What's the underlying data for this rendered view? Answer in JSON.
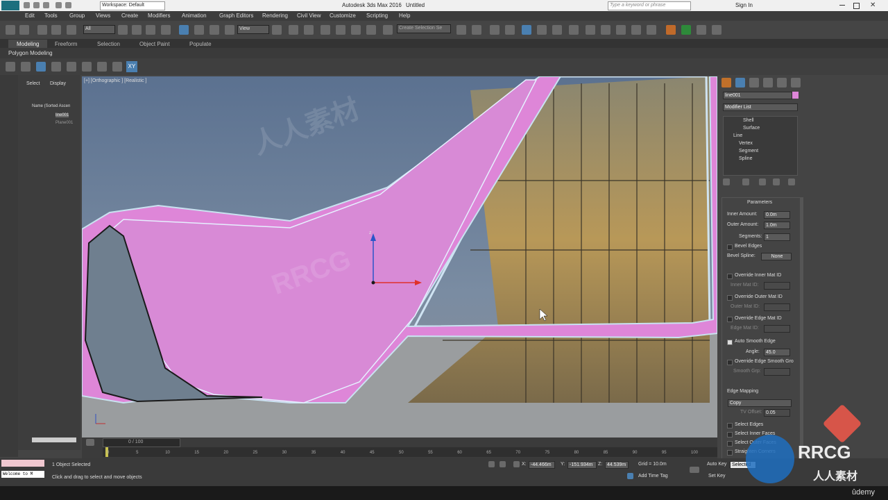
{
  "window": {
    "app_title": "Autodesk 3ds Max 2016",
    "doc_title": "Untitled",
    "workspace": "Workspace: Default",
    "search_placeholder": "Type a keyword or phrase",
    "sign_in": "Sign In"
  },
  "menu": [
    "Edit",
    "Tools",
    "Group",
    "Views",
    "Create",
    "Modifiers",
    "Animation",
    "Graph Editors",
    "Rendering",
    "Civil View",
    "Customize",
    "Scripting",
    "Help"
  ],
  "toolbar": {
    "filter_value": "All",
    "view_value": "View",
    "selection_set": "Create Selection Se"
  },
  "ribbon": {
    "tabs": [
      "Modeling",
      "Freeform",
      "Selection",
      "Object Paint",
      "Populate"
    ],
    "panel": "Polygon Modeling"
  },
  "scene_explorer": {
    "tabs": [
      "Select",
      "Display"
    ],
    "header": "Name (Sorted Ascen",
    "items": [
      "line001",
      "Plane001"
    ]
  },
  "viewport": {
    "label": "[+] [Orthographic ] [Realistic ]",
    "axis_z": "z"
  },
  "command_panel": {
    "object_name": "line001",
    "modifier_list": "Modifier List",
    "stack": [
      "Shell",
      "Surface",
      "Line",
      "Vertex",
      "Segment",
      "Spline"
    ],
    "parameters_title": "Parameters",
    "inner_amount_label": "Inner Amount:",
    "inner_amount": "0.0m",
    "outer_amount_label": "Outer Amount:",
    "outer_amount": "1.0m",
    "segments_label": "Segments:",
    "segments": "1",
    "bevel_edges": "Bevel Edges",
    "bevel_spline_label": "Bevel Spline:",
    "bevel_spline": "None",
    "override_inner": "Override Inner Mat ID",
    "inner_mat_id": "Inner Mat ID:",
    "override_outer": "Override Outer Mat ID",
    "outer_mat_id": "Outer Mat ID:",
    "override_edge": "Override Edge Mat ID",
    "edge_mat_id": "Edge Mat ID:",
    "auto_smooth": "Auto Smooth Edge",
    "angle_label": "Angle:",
    "angle": "45.0",
    "override_smooth": "Override Edge Smooth Gro",
    "smooth_grp": "Smooth Grp:",
    "edge_mapping": "Edge Mapping",
    "edge_mapping_value": "Copy",
    "tv_offset_label": "TV Offset:",
    "tv_offset": "0.05",
    "select_edges": "Select Edges",
    "select_inner": "Select Inner Faces",
    "select_outer": "Select Outer Faces",
    "straighten": "Straighten Corners"
  },
  "timeline": {
    "frame": "0 / 100",
    "ticks": [
      "0",
      "5",
      "10",
      "15",
      "20",
      "25",
      "30",
      "35",
      "40",
      "45",
      "50",
      "55",
      "60",
      "65",
      "70",
      "75",
      "80",
      "85",
      "90",
      "95",
      "100"
    ]
  },
  "status": {
    "selected": "1 Object Selected",
    "prompt": "Click and drag to select and move objects",
    "x_label": "X:",
    "x": "-44.466m",
    "y_label": "Y:",
    "y": "-151.934m",
    "z_label": "Z:",
    "z": "44.539m",
    "grid": "Grid = 10.0m",
    "add_time_tag": "Add Time Tag",
    "auto_key": "Auto Key",
    "set_key": "Set Key",
    "key_selected": "Selected",
    "maxscript": "Welcome to M"
  },
  "watermarks": {
    "brand": "RRCG",
    "chinese": "人人素材",
    "udemy": "ûdemy"
  }
}
